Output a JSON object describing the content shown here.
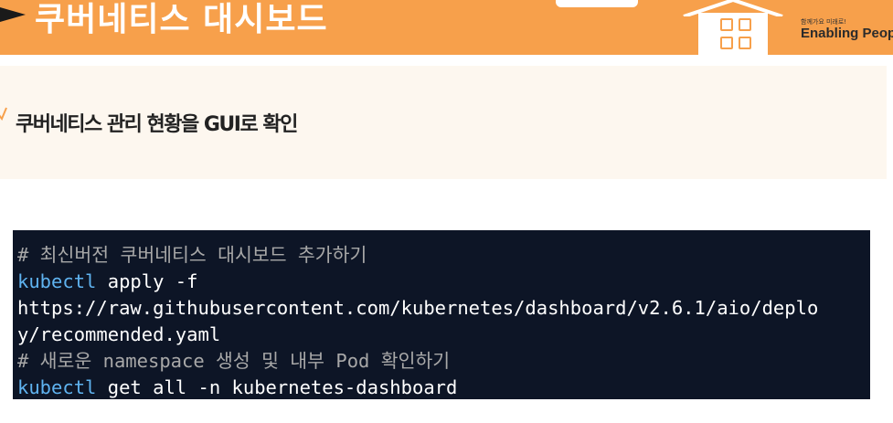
{
  "header": {
    "title": "쿠버네티스 대시보드",
    "brand_tagline": "함께가요 미래로!",
    "brand_name": "Enabling People",
    "colors": {
      "bar": "#f7a04b",
      "text": "#ffffff"
    }
  },
  "subtitle": {
    "text": "쿠버네티스 관리 현황을 GUI로 확인"
  },
  "code": {
    "lines": [
      {
        "type": "comment",
        "text": "# 최신버전 쿠버네티스 대시보드 추가하기"
      },
      {
        "type": "command",
        "cmd": "kubectl",
        "rest": " apply -f"
      },
      {
        "type": "text",
        "text": "https://raw.githubusercontent.com/kubernetes/dashboard/v2.6.1/aio/deplo"
      },
      {
        "type": "text",
        "text": "y/recommended.yaml"
      },
      {
        "type": "comment",
        "text": "# 새로운 namespace 생성 및 내부 Pod 확인하기"
      },
      {
        "type": "command",
        "cmd": "kubectl",
        "rest": " get all -n kubernetes-dashboard"
      }
    ],
    "colors": {
      "background": "#0d1526",
      "comment": "#a8a8a8",
      "command": "#5fb3f0",
      "text": "#ffffff"
    }
  }
}
